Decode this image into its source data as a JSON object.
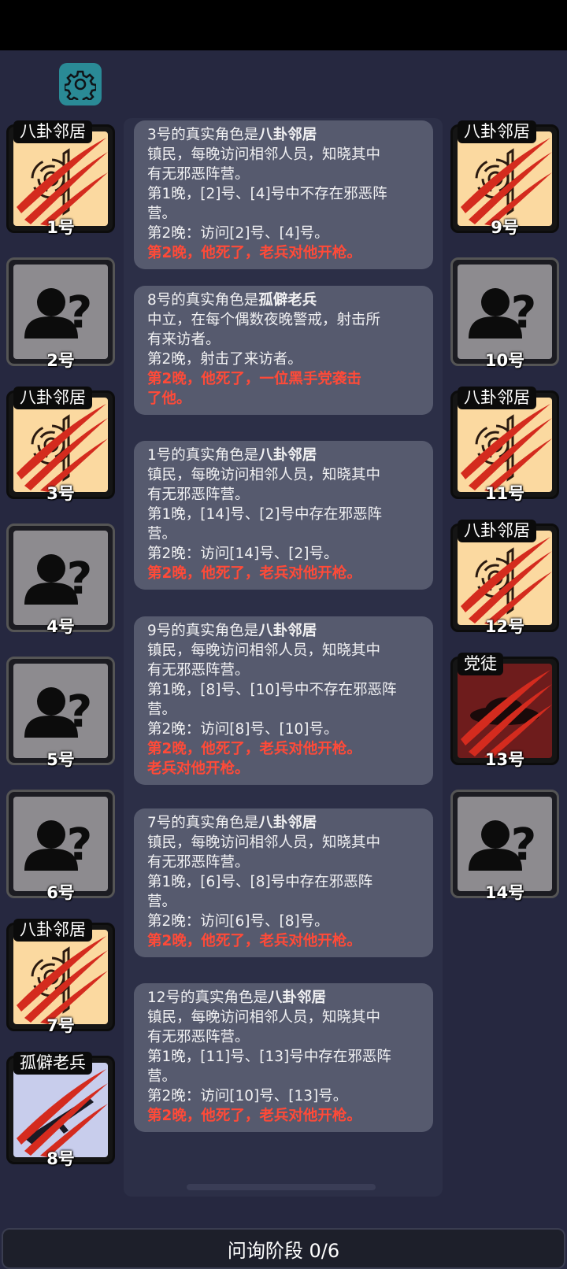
{
  "phase_bar": {
    "label": "问询阶段 0/6"
  },
  "colors": {
    "death_text": "#ff4a38",
    "card_bg": "#565a6e",
    "gear_bg": "#2a8a96"
  },
  "players_left": [
    {
      "num": "1号",
      "role": "八卦邻居",
      "state": "neighbor",
      "dead": true
    },
    {
      "num": "2号",
      "role": "",
      "state": "unknown",
      "dead": false
    },
    {
      "num": "3号",
      "role": "八卦邻居",
      "state": "neighbor",
      "dead": true
    },
    {
      "num": "4号",
      "role": "",
      "state": "unknown",
      "dead": false
    },
    {
      "num": "5号",
      "role": "",
      "state": "unknown",
      "dead": false
    },
    {
      "num": "6号",
      "role": "",
      "state": "unknown",
      "dead": false
    },
    {
      "num": "7号",
      "role": "八卦邻居",
      "state": "neighbor",
      "dead": true
    },
    {
      "num": "8号",
      "role": "孤僻老兵",
      "state": "veteran",
      "dead": true
    }
  ],
  "players_right": [
    {
      "num": "9号",
      "role": "八卦邻居",
      "state": "neighbor",
      "dead": true
    },
    {
      "num": "10号",
      "role": "",
      "state": "unknown",
      "dead": false
    },
    {
      "num": "11号",
      "role": "八卦邻居",
      "state": "neighbor",
      "dead": true
    },
    {
      "num": "12号",
      "role": "八卦邻居",
      "state": "neighbor",
      "dead": true
    },
    {
      "num": "13号",
      "role": "党徒",
      "state": "mafia",
      "dead": true
    },
    {
      "num": "14号",
      "role": "",
      "state": "unknown",
      "dead": false
    }
  ],
  "log": [
    {
      "title_prefix": "3号的真实角色是",
      "role": "八卦邻居",
      "lines": [
        "镇民，每晚访问相邻人员，知晓其中",
        "有无邪恶阵营。",
        "第1晚，[2]号、[4]号中不存在邪恶阵",
        "营。",
        "第2晚：访问[2]号、[4]号。"
      ],
      "death": [
        "第2晚，他死了，老兵对他开枪。"
      ]
    },
    {
      "title_prefix": "8号的真实角色是",
      "role": "孤僻老兵",
      "lines": [
        "中立，在每个偶数夜晚警戒，射击所",
        "有来访者。",
        "第2晚，射击了来访者。"
      ],
      "death": [
        "第2晚，他死了，一位黑手党袭击",
        "了他。"
      ]
    },
    {
      "title_prefix": "1号的真实角色是",
      "role": "八卦邻居",
      "lines": [
        "镇民，每晚访问相邻人员，知晓其中",
        "有无邪恶阵营。",
        "第1晚，[14]号、[2]号中存在邪恶阵",
        "营。",
        "第2晚：访问[14]号、[2]号。"
      ],
      "death": [
        "第2晚，他死了，老兵对他开枪。"
      ]
    },
    {
      "title_prefix": "9号的真实角色是",
      "role": "八卦邻居",
      "lines": [
        "镇民，每晚访问相邻人员，知晓其中",
        "有无邪恶阵营。",
        "第1晚，[8]号、[10]号中不存在邪恶阵",
        "营。",
        "第2晚：访问[8]号、[10]号。"
      ],
      "death": [
        "第2晚，他死了，老兵对他开枪。",
        "老兵对他开枪。"
      ]
    },
    {
      "title_prefix": "7号的真实角色是",
      "role": "八卦邻居",
      "lines": [
        "镇民，每晚访问相邻人员，知晓其中",
        "有无邪恶阵营。",
        "第1晚，[6]号、[8]号中存在邪恶阵",
        "营。",
        "第2晚：访问[6]号、[8]号。"
      ],
      "death": [
        "第2晚，他死了，老兵对他开枪。"
      ]
    },
    {
      "title_prefix": "12号的真实角色是",
      "role": "八卦邻居",
      "lines": [
        "镇民，每晚访问相邻人员，知晓其中",
        "有无邪恶阵营。",
        "第1晚，[11]号、[13]号中存在邪恶阵",
        "营。",
        "第2晚：访问[10]号、[13]号。"
      ],
      "death": [
        "第2晚，他死了，老兵对他开枪。"
      ]
    }
  ]
}
